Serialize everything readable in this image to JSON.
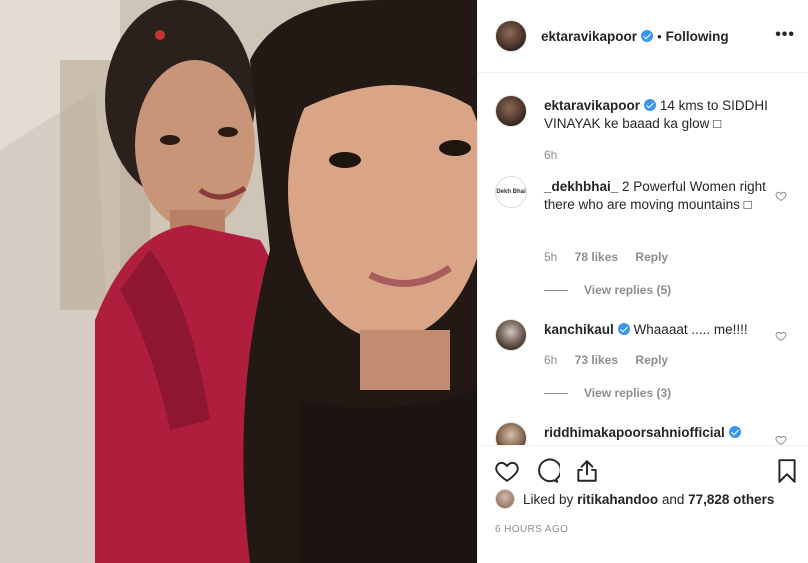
{
  "post": {
    "author": "ektaravikapoor",
    "follow_label": "Following",
    "more_label": "•••",
    "caption": {
      "username": "ektaravikapoor",
      "text": "14 kms to SIDDHI VINAYAK ke baaad ka glow □",
      "time": "6h"
    }
  },
  "comments": [
    {
      "username": "_dekhbhai_",
      "text": "2 Powerful Women right there who are moving mountains □",
      "time": "5h",
      "likes": "78 likes",
      "reply_label": "Reply",
      "view_replies": "View replies (5)",
      "avatar_text": "Dekh Bhai"
    },
    {
      "username": "kanchikaul",
      "text": "Whaaaat ..... me!!!!",
      "time": "6h",
      "likes": "73 likes",
      "reply_label": "Reply",
      "view_replies": "View replies (3)"
    },
    {
      "username": "riddhimakapoorsahniofficial",
      "text": ""
    }
  ],
  "likes_summary": {
    "prefix": "Liked by",
    "user": "ritikahandoo",
    "and_label": "and",
    "others": "77,828 others"
  },
  "timestamp": "6 HOURS AGO",
  "colors": {
    "verified": "#3897f0",
    "muted_text": "#8e8e8e",
    "text": "#262626",
    "divider": "#efefef"
  }
}
